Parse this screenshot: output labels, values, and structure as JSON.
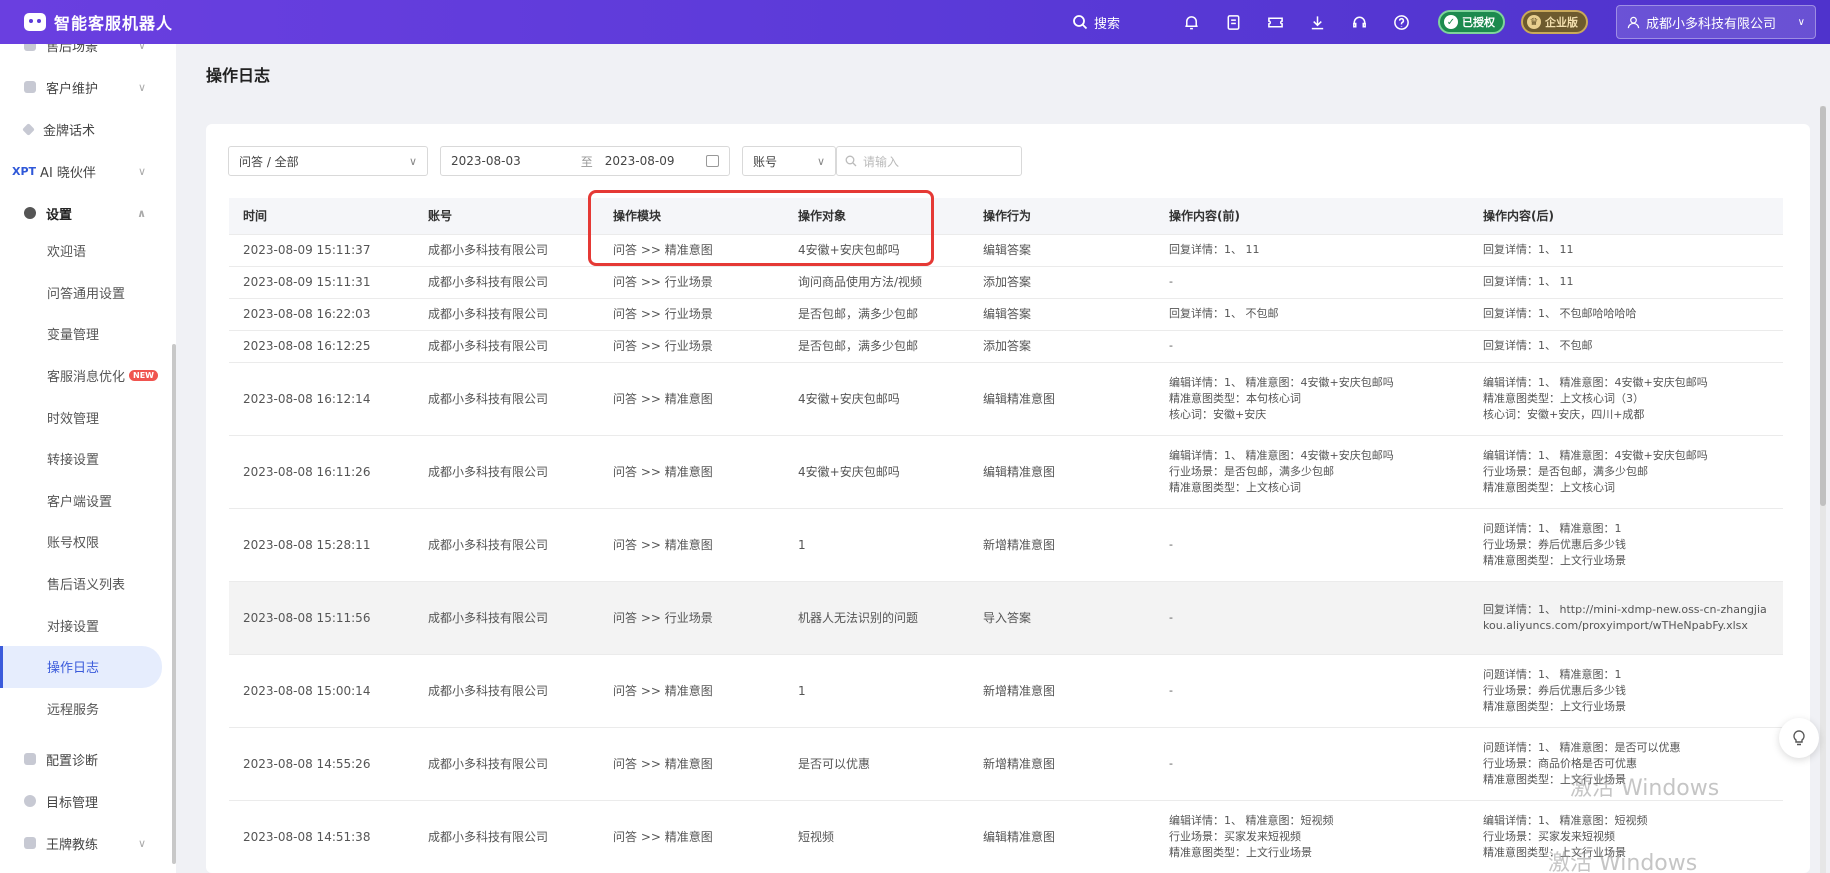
{
  "app": {
    "title": "智能客服机器人"
  },
  "topbar": {
    "search_label": "搜索",
    "badge_auth": "已授权",
    "badge_ent": "企业版",
    "user_name": "成都小多科技有限公司"
  },
  "sidebar": {
    "top_items": [
      {
        "label": "售后场景"
      },
      {
        "label": "客户维护"
      },
      {
        "label": "金牌话术"
      },
      {
        "label": "AI 晓伙伴",
        "prefix": "XPT"
      },
      {
        "label": "设置"
      }
    ],
    "sub_items": [
      {
        "label": "欢迎语"
      },
      {
        "label": "问答通用设置"
      },
      {
        "label": "变量管理"
      },
      {
        "label": "客服消息优化",
        "tag": "NEW"
      },
      {
        "label": "时效管理"
      },
      {
        "label": "转接设置"
      },
      {
        "label": "客户端设置"
      },
      {
        "label": "账号权限"
      },
      {
        "label": "售后语义列表"
      },
      {
        "label": "对接设置"
      },
      {
        "label": "操作日志"
      },
      {
        "label": "远程服务"
      }
    ],
    "bottom_items": [
      {
        "label": "配置诊断"
      },
      {
        "label": "目标管理"
      },
      {
        "label": "王牌教练"
      }
    ]
  },
  "page": {
    "title": "操作日志"
  },
  "filters": {
    "category": "问答 / 全部",
    "date_start": "2023-08-03",
    "date_sep": "至",
    "date_end": "2023-08-09",
    "account_select": "账号",
    "search_placeholder": "请输入"
  },
  "table": {
    "headers": [
      "时间",
      "账号",
      "操作模块",
      "操作对象",
      "操作行为",
      "操作内容(前)",
      "操作内容(后)"
    ],
    "rows": [
      {
        "time": "2023-08-09 15:11:37",
        "account": "成都小多科技有限公司",
        "module": "问答 >> 精准意图",
        "object": "4安徽+安庆包邮吗",
        "action": "编辑答案",
        "before": [
          "回复详情：1、 11"
        ],
        "after": [
          "回复详情：1、 11"
        ]
      },
      {
        "time": "2023-08-09 15:11:31",
        "account": "成都小多科技有限公司",
        "module": "问答 >> 行业场景",
        "object": "询问商品使用方法/视频",
        "action": "添加答案",
        "before": [
          "-"
        ],
        "after": [
          "回复详情：1、 11"
        ]
      },
      {
        "time": "2023-08-08 16:22:03",
        "account": "成都小多科技有限公司",
        "module": "问答 >> 行业场景",
        "object": "是否包邮，满多少包邮",
        "action": "编辑答案",
        "before": [
          "回复详情：1、 不包邮"
        ],
        "after": [
          "回复详情：1、 不包邮哈哈哈哈"
        ]
      },
      {
        "time": "2023-08-08 16:12:25",
        "account": "成都小多科技有限公司",
        "module": "问答 >> 行业场景",
        "object": "是否包邮，满多少包邮",
        "action": "添加答案",
        "before": [
          "-"
        ],
        "after": [
          "回复详情：1、 不包邮"
        ]
      },
      {
        "time": "2023-08-08 16:12:14",
        "account": "成都小多科技有限公司",
        "module": "问答 >> 精准意图",
        "object": "4安徽+安庆包邮吗",
        "action": "编辑精准意图",
        "before": [
          "编辑详情：1、 精准意图：4安徽+安庆包邮吗",
          "精准意图类型：本句核心词",
          "核心词：安徽+安庆"
        ],
        "after": [
          "编辑详情：1、 精准意图：4安徽+安庆包邮吗",
          "精准意图类型：上文核心词（3）",
          "核心词：安徽+安庆，四川+成都"
        ]
      },
      {
        "time": "2023-08-08 16:11:26",
        "account": "成都小多科技有限公司",
        "module": "问答 >> 精准意图",
        "object": "4安徽+安庆包邮吗",
        "action": "编辑精准意图",
        "before": [
          "编辑详情：1、 精准意图：4安徽+安庆包邮吗",
          "行业场景：是否包邮，满多少包邮",
          "精准意图类型：上文核心词"
        ],
        "after": [
          "编辑详情：1、 精准意图：4安徽+安庆包邮吗",
          "行业场景：是否包邮，满多少包邮",
          "精准意图类型：上文核心词"
        ]
      },
      {
        "time": "2023-08-08 15:28:11",
        "account": "成都小多科技有限公司",
        "module": "问答 >> 精准意图",
        "object": "1",
        "action": "新增精准意图",
        "before": [
          "-"
        ],
        "after": [
          "问题详情：1、 精准意图：1",
          "行业场景：券后优惠后多少钱",
          "精准意图类型：上文行业场景"
        ]
      },
      {
        "time": "2023-08-08 15:11:56",
        "account": "成都小多科技有限公司",
        "module": "问答 >> 行业场景",
        "object": "机器人无法识别的问题",
        "action": "导入答案",
        "before": [
          "-"
        ],
        "after": [
          "回复详情：1、 http://mini-xdmp-new.oss-cn-zhangjiakou.aliyuncs.com/proxyimport/wTHeNpabFy.xlsx"
        ]
      },
      {
        "time": "2023-08-08 15:00:14",
        "account": "成都小多科技有限公司",
        "module": "问答 >> 精准意图",
        "object": "1",
        "action": "新增精准意图",
        "before": [
          "-"
        ],
        "after": [
          "问题详情：1、 精准意图：1",
          "行业场景：券后优惠后多少钱",
          "精准意图类型：上文行业场景"
        ]
      },
      {
        "time": "2023-08-08 14:55:26",
        "account": "成都小多科技有限公司",
        "module": "问答 >> 精准意图",
        "object": "是否可以优惠",
        "action": "新增精准意图",
        "before": [
          "-"
        ],
        "after": [
          "问题详情：1、 精准意图：是否可以优惠",
          "行业场景：商品价格是否可优惠",
          "精准意图类型：上文行业场景"
        ]
      },
      {
        "time": "2023-08-08 14:51:38",
        "account": "成都小多科技有限公司",
        "module": "问答 >> 精准意图",
        "object": "短视频",
        "action": "编辑精准意图",
        "before": [
          "编辑详情：1、 精准意图：短视频",
          "行业场景：买家发来短视频",
          "精准意图类型：上文行业场景"
        ],
        "after": [
          "编辑详情：1、 精准意图：短视频",
          "行业场景：买家发来短视频",
          "精准意图类型：上文行业场景"
        ]
      }
    ]
  },
  "watermark": {
    "line1": "激活 Windows",
    "line2": "激活 Windows"
  }
}
